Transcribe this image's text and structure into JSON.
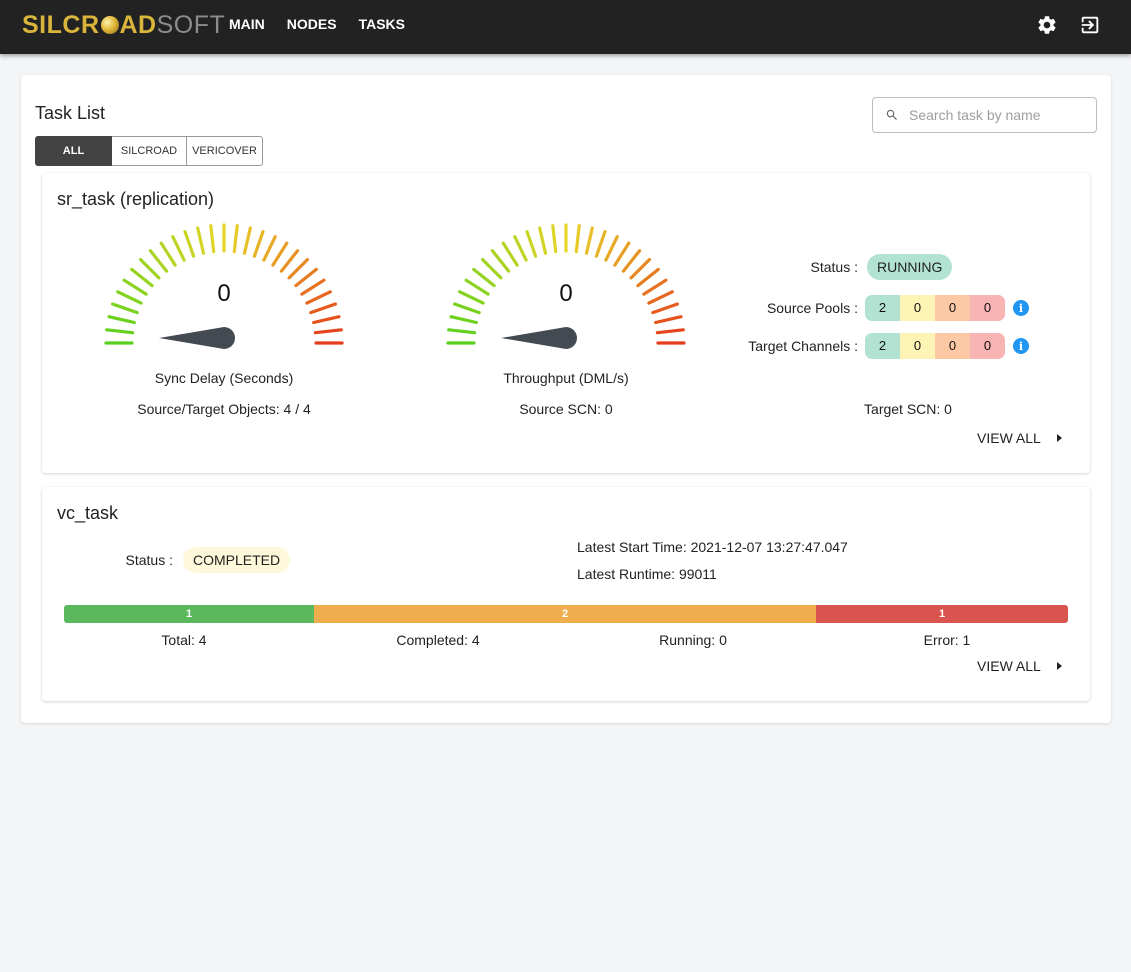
{
  "brand": {
    "part1": "SILCR",
    "part2": "AD",
    "part3": "SOFT"
  },
  "nav": {
    "items": [
      "MAIN",
      "NODES",
      "TASKS"
    ]
  },
  "icons": {
    "settings": "gear-icon",
    "logout": "logout-icon",
    "search": "search-icon",
    "info": "info-icon",
    "caret": "caret-right-icon"
  },
  "page": {
    "title": "Task List",
    "filters": [
      "ALL",
      "SILCROAD",
      "VERICOVER"
    ],
    "active_filter": "ALL",
    "search_placeholder": "Search task by name"
  },
  "tasks": [
    {
      "name": "sr_task (replication)",
      "gauges": [
        {
          "value": "0",
          "label": "Sync Delay (Seconds)",
          "footer": "Source/Target Objects: 4 / 4"
        },
        {
          "value": "0",
          "label": "Throughput (DML/s)",
          "footer": "Source SCN: 0"
        }
      ],
      "status_label": "Status :",
      "status": "RUNNING",
      "source_pools_label": "Source Pools :",
      "source_pools": [
        "2",
        "0",
        "0",
        "0"
      ],
      "target_channels_label": "Target Channels :",
      "target_channels": [
        "2",
        "0",
        "0",
        "0"
      ],
      "target_scn": "Target SCN: 0",
      "view_all": "VIEW ALL"
    },
    {
      "name": "vc_task",
      "status_label": "Status :",
      "status": "COMPLETED",
      "latest_start": "Latest Start Time: 2021-12-07 13:27:47.047",
      "latest_runtime": "Latest Runtime: 99011",
      "progress": [
        {
          "label": "1",
          "value": 1,
          "color": "#5cb85c"
        },
        {
          "label": "2",
          "value": 2,
          "color": "#f0ad4e"
        },
        {
          "label": "1",
          "value": 1,
          "color": "#d9534f"
        }
      ],
      "totals": {
        "total": "Total: 4",
        "completed": "Completed: 4",
        "running": "Running: 0",
        "error": "Error: 1"
      },
      "view_all": "VIEW ALL"
    }
  ],
  "colors": {
    "running_chip": "#b2e3d2",
    "completed_chip": "#fdf8d9",
    "seg_green": "#b2e3d2",
    "seg_yellow": "#fdf3b4",
    "seg_orange": "#fdc9a5",
    "seg_red": "#f8b3b3",
    "gauge_start": "#59d11c",
    "gauge_mid": "#e8d52a",
    "gauge_end": "#e53a1b",
    "needle": "#444a52"
  }
}
